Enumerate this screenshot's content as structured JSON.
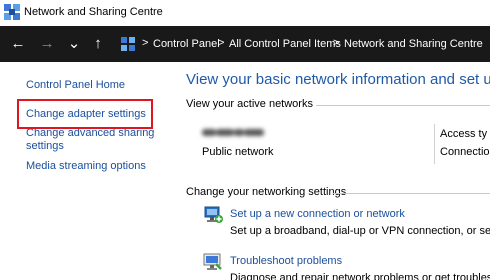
{
  "window": {
    "title": "Network and Sharing Centre"
  },
  "address_bar": {
    "crumbs": [
      "Control Panel",
      "All Control Panel Items",
      "Network and Sharing Centre"
    ],
    "separator": ">"
  },
  "nav": {
    "back": "←",
    "forward": "→",
    "recent": "⌄",
    "up": "↑"
  },
  "sidebar": {
    "items": [
      {
        "label": "Control Panel Home"
      },
      {
        "label": "Change adapter settings",
        "highlighted": true
      },
      {
        "label": "Change advanced sharing",
        "label2": "settings"
      },
      {
        "label": "Media streaming options"
      }
    ]
  },
  "main": {
    "heading": "View your basic network information and set up con",
    "active_networks_label": "View your active networks",
    "network": {
      "type": "Public network",
      "access_label": "Access ty",
      "connection_label": "Connectio"
    },
    "change_settings_label": "Change your networking settings",
    "tasks": [
      {
        "link": "Set up a new connection or network",
        "desc": "Set up a broadband, dial-up or VPN connection, or set up a"
      },
      {
        "link": "Troubleshoot problems",
        "desc": "Diagnose and repair network problems or get troubleshoot"
      }
    ]
  },
  "colors": {
    "link": "#1a4f9c",
    "heading": "#1e5aa8",
    "highlight": "#e0161e",
    "navbar": "#191919"
  }
}
